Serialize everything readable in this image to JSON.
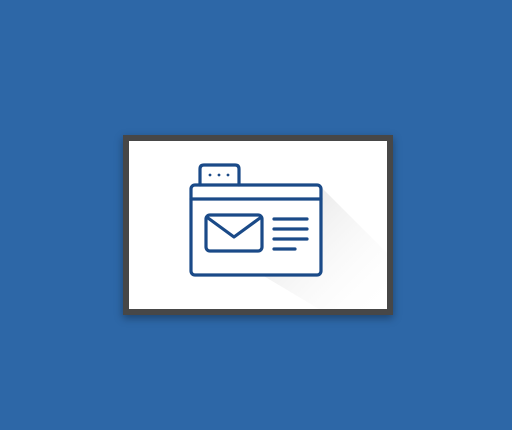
{
  "colors": {
    "background": "#2d67a7",
    "frame": "#474747",
    "card": "#ffffff",
    "icon_stroke": "#1a4a88",
    "long_shadow": "#e6e6e6"
  },
  "icon": {
    "name": "email-webpage-icon",
    "parts": [
      "browser-window-icon",
      "browser-tab-icon",
      "envelope-icon",
      "text-lines-icon"
    ]
  }
}
